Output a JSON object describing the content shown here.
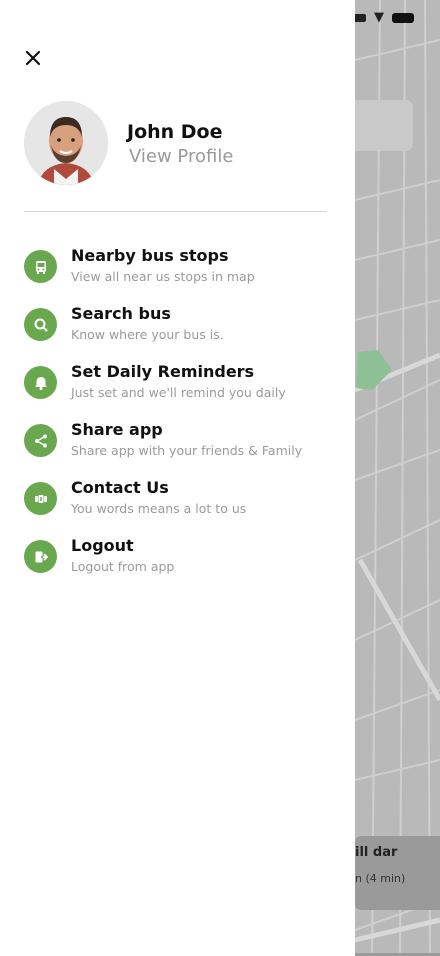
{
  "user": {
    "name": "John Doe",
    "profile_link": "View Profile"
  },
  "menu": [
    {
      "id": "nearby",
      "title": "Nearby bus stops",
      "subtitle": "View all near us stops in map",
      "icon": "bus-icon"
    },
    {
      "id": "search",
      "title": "Search bus",
      "subtitle": "Know where your bus is.",
      "icon": "search-icon"
    },
    {
      "id": "reminders",
      "title": "Set Daily Reminders",
      "subtitle": "Just set and we'll remind you daily",
      "icon": "bell-icon"
    },
    {
      "id": "share",
      "title": "Share app",
      "subtitle": "Share app with your friends & Family",
      "icon": "share-icon"
    },
    {
      "id": "contact",
      "title": "Contact Us",
      "subtitle": "You words means a lot to us",
      "icon": "contact-icon"
    },
    {
      "id": "logout",
      "title": "Logout",
      "subtitle": "Logout from app",
      "icon": "logout-icon"
    }
  ],
  "map_card": {
    "line1": "ill dar",
    "line2": "n (4 min)"
  },
  "colors": {
    "accent": "#6aa84f",
    "map_bg": "#b9b9b9"
  }
}
